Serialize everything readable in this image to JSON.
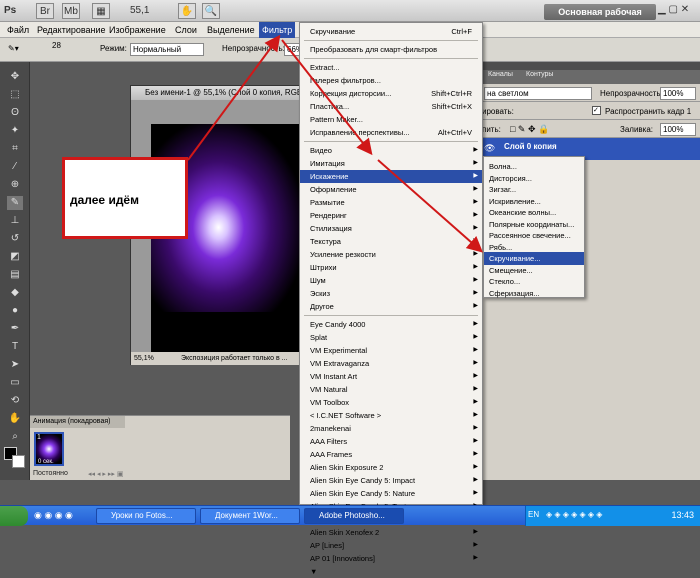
{
  "titlebar": {
    "app": "Ps",
    "zoom": "55,1",
    "workspace": "Основная рабочая среда",
    "br": "Br",
    "mb": "Mb"
  },
  "menubar": [
    "Файл",
    "Редактирование",
    "Изображение",
    "Слои",
    "Выделение",
    "Фильтр"
  ],
  "options": {
    "size": "28",
    "mode_label": "Режим:",
    "mode_value": "Нормальный",
    "opacity_label": "Непрозрачность:",
    "opacity_value": "66%"
  },
  "document": {
    "title": "Без имени-1 @ 55,1% (Слой 0 копия, RGB",
    "zoom": "55,1%",
    "status": "Экспозиция работает только в ..."
  },
  "rightpanel": {
    "tab1": "Каналы",
    "tab2": "Контуры",
    "row1_value": "на светлом",
    "row1_opacity_label": "Непрозрачность:",
    "row1_opacity_value": "100%",
    "row2_label": "ировать:",
    "row2_check": "Распространить кадр 1",
    "row3_label": "пить:",
    "row3_fill_label": "Заливка:",
    "row3_fill_value": "100%",
    "layer_name": "Слой 0 копия"
  },
  "animation": {
    "title": "Анимация (покадровая)",
    "frame_num": "1",
    "frame_time": "0 сек.",
    "loop": "Постоянно"
  },
  "filter_menu": {
    "top": [
      {
        "label": "Скручивание",
        "shortcut": "Ctrl+F"
      },
      {
        "label": "Преобразовать для смарт-фильтров",
        "shortcut": ""
      }
    ],
    "group2": [
      {
        "label": "Extract...",
        "shortcut": ""
      },
      {
        "label": "Галерея фильтров...",
        "shortcut": ""
      },
      {
        "label": "Коррекция дисторсии...",
        "shortcut": "Shift+Ctrl+R"
      },
      {
        "label": "Пластика...",
        "shortcut": "Shift+Ctrl+X"
      },
      {
        "label": "Pattern Maker...",
        "shortcut": ""
      },
      {
        "label": "Исправление перспективы...",
        "shortcut": "Alt+Ctrl+V"
      }
    ],
    "group3": [
      "Видео",
      "Имитация",
      "Искажение",
      "Оформление",
      "Размытие",
      "Рендеринг",
      "Стилизация",
      "Текстура",
      "Усиление резкости",
      "Штрихи",
      "Шум",
      "Эскиз",
      "Другое"
    ],
    "group4": [
      "Eye Candy 4000",
      "Splat",
      "VM Experimental",
      "VM Extravaganza",
      "VM Instant Art",
      "VM Natural",
      "VM Toolbox",
      "< I.C.NET Software >",
      "2manekenai",
      "AAA Filters",
      "AAA Frames",
      "Alien Skin Exposure 2",
      "Alien Skin Eye Candy 5: Impact",
      "Alien Skin Eye Candy 5: Nature",
      "Alien Skin Eye Candy 5: Textures",
      "Alien Skin Snap Art",
      "Alien Skin Xenofex 2",
      "AP [Lines]",
      "AP 01 [Innovations]"
    ],
    "more": "▼"
  },
  "distort_submenu": [
    "Волна...",
    "Дисторсия...",
    "Зигзаг...",
    "Искривление...",
    "Океанские волны...",
    "Полярные координаты...",
    "Рассеянное свечение...",
    "Рябь...",
    "Скручивание...",
    "Смещение...",
    "Стекло...",
    "Сферизация..."
  ],
  "callout": {
    "text": "далее идём"
  },
  "taskbar": {
    "btn1": "Уроки по Fotos...",
    "btn2": "Документ 1Wor...",
    "btn3": "Adobe Photosho...",
    "lang": "EN",
    "clock": "13:43"
  },
  "colors": {
    "highlight": "#2b4fa8",
    "arrow": "#d01818"
  }
}
